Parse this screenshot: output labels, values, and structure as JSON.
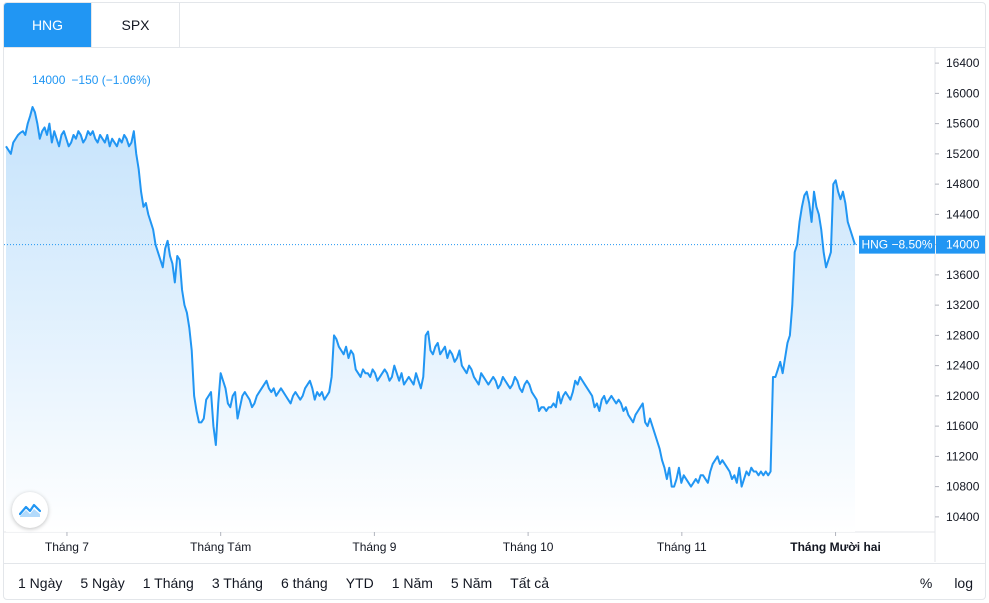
{
  "tabs": [
    {
      "label": "HNG",
      "active": true
    },
    {
      "label": "SPX",
      "active": false
    }
  ],
  "info": {
    "price": "14000",
    "change": "−150 (−1.06%)"
  },
  "price_tag": {
    "label": "HNG −8.50%",
    "value": "14000"
  },
  "range_buttons": [
    "1 Ngày",
    "5 Ngày",
    "1 Tháng",
    "3 Tháng",
    "6 tháng",
    "YTD",
    "1 Năm",
    "5 Năm",
    "Tất cả"
  ],
  "right_controls": {
    "percent": "%",
    "log": "log"
  },
  "colors": {
    "accent": "#2196f3",
    "line": "#2196f3",
    "fill_top": "#bbdefb",
    "fill_bottom": "#ffffff",
    "grid": "#e3e6ea"
  },
  "icons": {
    "logo": "tradingview-logo-icon"
  },
  "chart_data": {
    "type": "area",
    "title": "",
    "xlabel": "",
    "ylabel": "",
    "ylim": [
      10200,
      16600
    ],
    "y_ticks": [
      10400,
      10800,
      11200,
      11600,
      12000,
      12400,
      12800,
      13200,
      13600,
      14000,
      14400,
      14800,
      15200,
      15600,
      16000,
      16400
    ],
    "x_ticks": [
      {
        "label": "Tháng 7",
        "pos": 8.6,
        "bold": false
      },
      {
        "label": "Tháng Tám",
        "pos": 29.6,
        "bold": false
      },
      {
        "label": "Tháng 9",
        "pos": 50.6,
        "bold": false
      },
      {
        "label": "Tháng 10",
        "pos": 71.6,
        "bold": false
      },
      {
        "label": "Tháng 11",
        "pos": 92.6,
        "bold": false
      },
      {
        "label": "Tháng Mười hai",
        "pos": 113.6,
        "bold": true
      }
    ],
    "baseline": 14000,
    "last_value": 14000,
    "series": [
      {
        "values": [
          15300,
          15250,
          15200,
          15350,
          15400,
          15450,
          15480,
          15500,
          15450,
          15600,
          15700,
          15820,
          15750,
          15600,
          15400,
          15500,
          15550,
          15450,
          15600,
          15350,
          15500,
          15400,
          15300,
          15450,
          15500,
          15400,
          15300,
          15350,
          15450,
          15400,
          15500,
          15450,
          15350,
          15400,
          15500,
          15450,
          15500,
          15400,
          15350,
          15450,
          15400,
          15350,
          15450,
          15300,
          15400,
          15350,
          15300,
          15400,
          15350,
          15450,
          15400,
          15300,
          15350,
          15500,
          15200,
          15000,
          14700,
          14500,
          14550,
          14400,
          14300,
          14200,
          14000,
          13900,
          13800,
          13700,
          13950,
          14050,
          13850,
          13750,
          13500,
          13850,
          13800,
          13400,
          13200,
          13100,
          12900,
          12600,
          12000,
          11800,
          11650,
          11650,
          11700,
          11950,
          12000,
          12050,
          11600,
          11350,
          11900,
          12300,
          12200,
          12100,
          11900,
          11850,
          12000,
          12050,
          11700,
          11850,
          12000,
          12050,
          12000,
          11950,
          11850,
          11900,
          12000,
          12050,
          12100,
          12150,
          12200,
          12100,
          12050,
          12100,
          12000,
          12050,
          12100,
          12050,
          12000,
          11950,
          11900,
          12000,
          12050,
          12000,
          11950,
          12000,
          12100,
          12150,
          12200,
          12100,
          11950,
          12050,
          12000,
          12050,
          11950,
          12000,
          12050,
          12250,
          12800,
          12750,
          12650,
          12600,
          12550,
          12650,
          12500,
          12600,
          12550,
          12350,
          12300,
          12250,
          12350,
          12300,
          12300,
          12250,
          12350,
          12300,
          12200,
          12250,
          12300,
          12350,
          12300,
          12200,
          12250,
          12400,
          12300,
          12200,
          12300,
          12150,
          12200,
          12250,
          12200,
          12150,
          12300,
          12200,
          12100,
          12250,
          12800,
          12850,
          12600,
          12550,
          12650,
          12700,
          12550,
          12600,
          12650,
          12500,
          12600,
          12550,
          12450,
          12500,
          12600,
          12400,
          12350,
          12300,
          12400,
          12350,
          12250,
          12200,
          12150,
          12300,
          12250,
          12200,
          12150,
          12200,
          12250,
          12200,
          12100,
          12150,
          12250,
          12200,
          12150,
          12100,
          12150,
          12250,
          12200,
          12100,
          12050,
          12150,
          12200,
          12150,
          12050,
          12000,
          11950,
          11800,
          11850,
          11850,
          11800,
          11850,
          11850,
          11900,
          11850,
          12050,
          11900,
          12000,
          12050,
          12000,
          11950,
          12050,
          12200,
          12150,
          12250,
          12200,
          12150,
          12100,
          12050,
          12000,
          11850,
          11900,
          11800,
          11950,
          12000,
          11900,
          11950,
          12000,
          11950,
          11900,
          11950,
          11900,
          11800,
          11850,
          11750,
          11700,
          11650,
          11750,
          11800,
          11850,
          11900,
          11650,
          11600,
          11700,
          11600,
          11500,
          11400,
          11300,
          11150,
          11050,
          10900,
          11050,
          10800,
          10800,
          10900,
          11050,
          10850,
          10950,
          10900,
          10850,
          10800,
          10850,
          10900,
          10850,
          10950,
          10950,
          10900,
          10850,
          11000,
          11100,
          11150,
          11200,
          11100,
          11150,
          11100,
          11050,
          11000,
          10900,
          10950,
          10850,
          11050,
          10800,
          10900,
          11000,
          10950,
          11050,
          11000,
          11000,
          10950,
          11000,
          10950,
          11000,
          10950,
          11000,
          12250,
          12250,
          12350,
          12450,
          12300,
          12500,
          12700,
          12800,
          13200,
          13900,
          14000,
          14300,
          14500,
          14650,
          14700,
          14550,
          14300,
          14700,
          14500,
          14400,
          14200,
          13900,
          13700,
          13800,
          13900,
          14800,
          14850,
          14700,
          14600,
          14700,
          14550,
          14300,
          14200,
          14100,
          14000
        ]
      }
    ]
  }
}
